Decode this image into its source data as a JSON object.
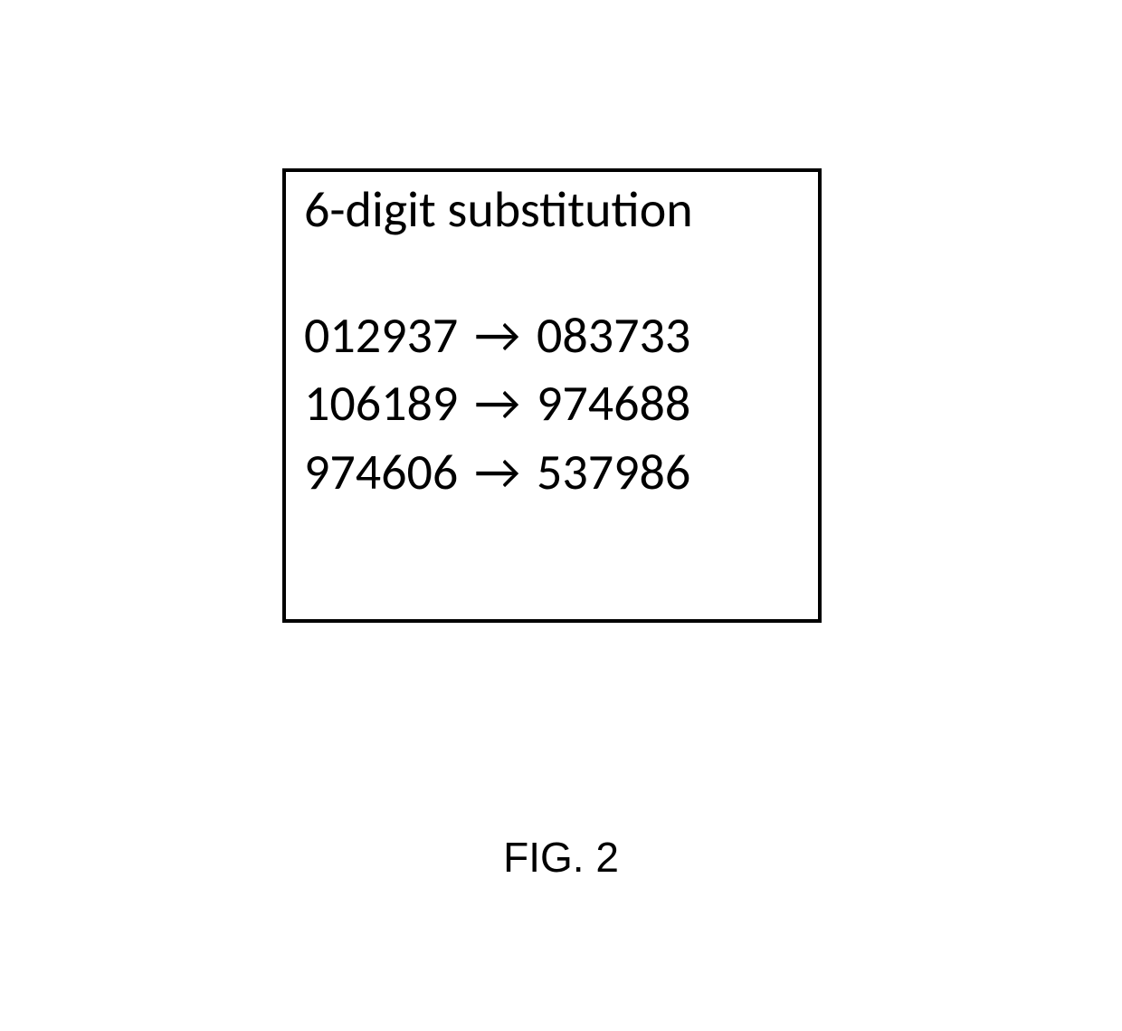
{
  "box": {
    "heading": "6-digit substitution",
    "mappings": [
      {
        "from": "012937",
        "to": "083733"
      },
      {
        "from": "106189",
        "to": "974688"
      },
      {
        "from": "974606",
        "to": "537986"
      }
    ],
    "arrow_glyph": "→"
  },
  "caption": "FIG. 2"
}
